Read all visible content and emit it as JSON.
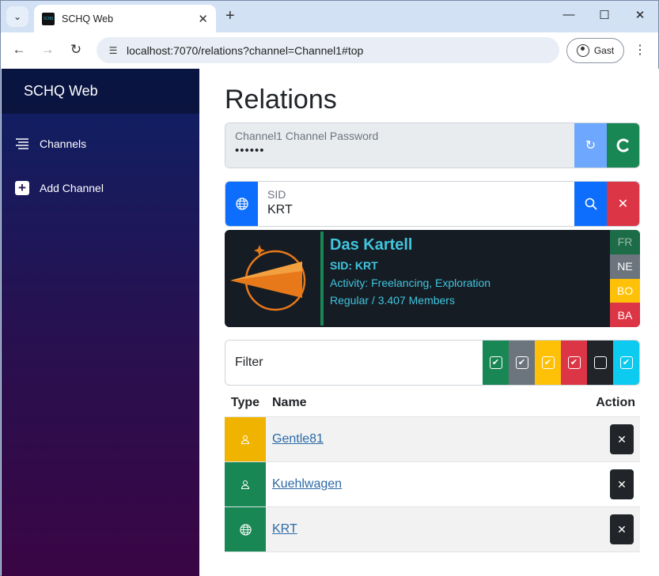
{
  "browser": {
    "tab_title": "SCHQ Web",
    "favicon_text": "SCHQ",
    "url": "localhost:7070/relations?channel=Channel1#top",
    "profile_label": "Gast"
  },
  "sidebar": {
    "brand": "SCHQ Web",
    "items": [
      {
        "label": "Channels",
        "icon": "list-icon"
      },
      {
        "label": "Add Channel",
        "icon": "plus-square-icon"
      }
    ]
  },
  "main": {
    "title": "Relations",
    "password": {
      "label": "Channel1 Channel Password",
      "value": "••••••"
    },
    "sid": {
      "label": "SID",
      "value": "KRT"
    },
    "org": {
      "name": "Das Kartell",
      "sid_line": "SID: KRT",
      "activity_line": "Activity: Freelancing, Exploration",
      "members_line": "Regular / 3.407 Members"
    },
    "relation_tags": [
      "FR",
      "NE",
      "BO",
      "BA"
    ],
    "filter": {
      "label": "Filter",
      "checkboxes": [
        {
          "color": "#198754",
          "checked": true
        },
        {
          "color": "#6c757d",
          "checked": true
        },
        {
          "color": "#ffc107",
          "checked": true
        },
        {
          "color": "#dc3545",
          "checked": true
        },
        {
          "color": "#212529",
          "checked": false
        },
        {
          "color": "#0dcaf0",
          "checked": true
        }
      ]
    },
    "table": {
      "headers": {
        "type": "Type",
        "name": "Name",
        "action": "Action"
      },
      "rows": [
        {
          "name": "Gentle81",
          "type_icon": "person-icon",
          "color": "#f0b400"
        },
        {
          "name": "Kuehlwagen",
          "type_icon": "person-icon",
          "color": "#198754"
        },
        {
          "name": "KRT",
          "type_icon": "globe-icon",
          "color": "#198754"
        }
      ]
    }
  },
  "colors": {
    "accent_blue": "#0d6efd",
    "success": "#198754",
    "danger": "#dc3545",
    "org_text": "#3fc6de"
  }
}
